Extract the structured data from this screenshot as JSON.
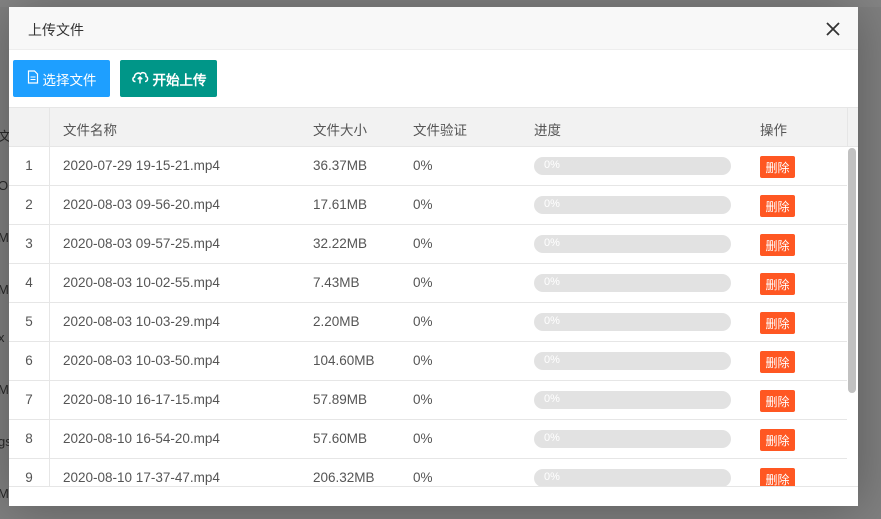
{
  "modal": {
    "title": "上传文件",
    "close_icon": "close-icon"
  },
  "toolbar": {
    "select_label": "选择文件",
    "select_icon": "file-icon",
    "upload_label": "开始上传",
    "upload_icon": "cloud-upload-icon"
  },
  "table": {
    "headers": [
      "",
      "文件名称",
      "文件大小",
      "文件验证",
      "进度",
      "操作"
    ],
    "rows": [
      {
        "index": "1",
        "name": "2020-07-29 19-15-21.mp4",
        "size": "36.37MB",
        "verify": "0%",
        "progress": "0%",
        "progress_value": 0,
        "action": "删除"
      },
      {
        "index": "2",
        "name": "2020-08-03 09-56-20.mp4",
        "size": "17.61MB",
        "verify": "0%",
        "progress": "0%",
        "progress_value": 0,
        "action": "删除"
      },
      {
        "index": "3",
        "name": "2020-08-03 09-57-25.mp4",
        "size": "32.22MB",
        "verify": "0%",
        "progress": "0%",
        "progress_value": 0,
        "action": "删除"
      },
      {
        "index": "4",
        "name": "2020-08-03 10-02-55.mp4",
        "size": "7.43MB",
        "verify": "0%",
        "progress": "0%",
        "progress_value": 0,
        "action": "删除"
      },
      {
        "index": "5",
        "name": "2020-08-03 10-03-29.mp4",
        "size": "2.20MB",
        "verify": "0%",
        "progress": "0%",
        "progress_value": 0,
        "action": "删除"
      },
      {
        "index": "6",
        "name": "2020-08-03 10-03-50.mp4",
        "size": "104.60MB",
        "verify": "0%",
        "progress": "0%",
        "progress_value": 0,
        "action": "删除"
      },
      {
        "index": "7",
        "name": "2020-08-10 16-17-15.mp4",
        "size": "57.89MB",
        "verify": "0%",
        "progress": "0%",
        "progress_value": 0,
        "action": "删除"
      },
      {
        "index": "8",
        "name": "2020-08-10 16-54-20.mp4",
        "size": "57.60MB",
        "verify": "0%",
        "progress": "0%",
        "progress_value": 0,
        "action": "删除"
      },
      {
        "index": "9",
        "name": "2020-08-10 17-37-47.mp4",
        "size": "206.32MB",
        "verify": "0%",
        "progress": "0%",
        "progress_value": 0,
        "action": "删除"
      }
    ]
  },
  "background": {
    "fragments": [
      "文",
      "ON",
      "M",
      "M",
      "x",
      "M",
      "gs",
      "M"
    ]
  },
  "colors": {
    "select_button": "#1e9fff",
    "upload_button": "#009688",
    "delete_button": "#ff5722",
    "progress_track": "#e2e2e2"
  }
}
